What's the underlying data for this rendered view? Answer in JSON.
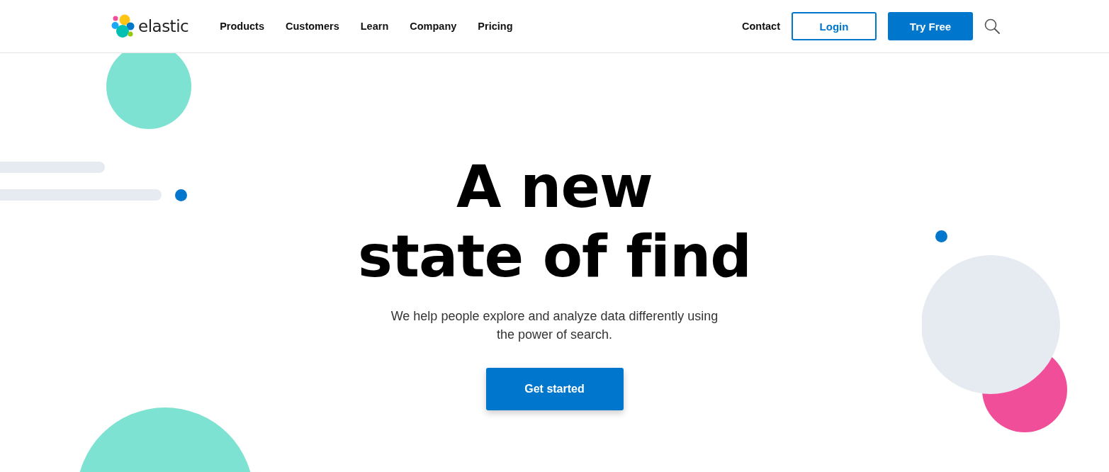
{
  "header": {
    "logo_text": "elastic",
    "nav": [
      {
        "label": "Products"
      },
      {
        "label": "Customers"
      },
      {
        "label": "Learn"
      },
      {
        "label": "Company"
      },
      {
        "label": "Pricing"
      }
    ],
    "contact": "Contact",
    "login": "Login",
    "try_free": "Try Free"
  },
  "hero": {
    "headline": [
      "A new",
      "state of find"
    ],
    "subtitle": "We help people explore and analyze data differently using the power of search.",
    "cta": "Get started"
  }
}
